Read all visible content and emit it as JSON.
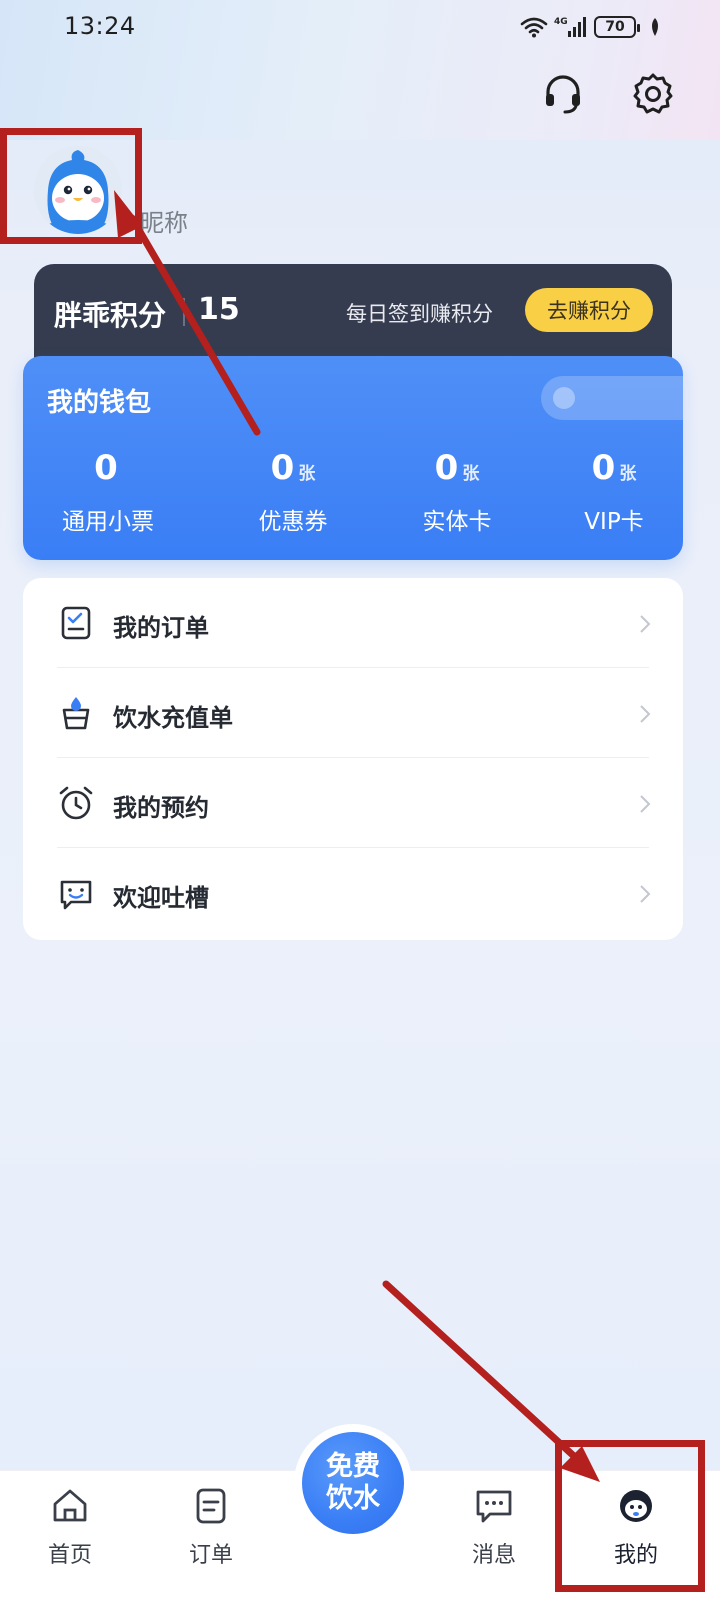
{
  "status_bar": {
    "time": "13:24",
    "network_label": "4G",
    "battery_level": "70"
  },
  "header": {
    "support_icon": "headset-icon",
    "settings_icon": "gear-icon"
  },
  "profile": {
    "avatar_icon": "penguin-avatar",
    "nickname": "昵称"
  },
  "points": {
    "label": "胖乖积分",
    "value": "15",
    "hint": "每日签到赚积分",
    "earn_button": "去赚积分"
  },
  "wallet": {
    "title": "我的钱包",
    "items": [
      {
        "count": "0",
        "unit": "",
        "label": "通用小票"
      },
      {
        "count": "0",
        "unit": "张",
        "label": "优惠券"
      },
      {
        "count": "0",
        "unit": "张",
        "label": "实体卡"
      },
      {
        "count": "0",
        "unit": "张",
        "label": "VIP卡"
      }
    ]
  },
  "menu": {
    "items": [
      {
        "label": "我的订单",
        "icon": "order-checklist-icon"
      },
      {
        "label": "饮水充值单",
        "icon": "water-cup-icon"
      },
      {
        "label": "我的预约",
        "icon": "alarm-clock-icon"
      },
      {
        "label": "欢迎吐槽",
        "icon": "feedback-chat-icon"
      }
    ]
  },
  "bottom_nav": {
    "items": [
      {
        "label": "首页",
        "icon": "home-icon"
      },
      {
        "label": "订单",
        "icon": "order-doc-icon"
      },
      {
        "label": "消息",
        "icon": "message-icon"
      },
      {
        "label": "我的",
        "icon": "profile-face-icon"
      }
    ],
    "center_line1": "免费",
    "center_line2": "饮水"
  },
  "colors": {
    "accent_blue": "#3a7ef6",
    "points_bg": "#353c4f",
    "earn_yellow": "#f8cf45",
    "annotation_red": "#b3201d"
  }
}
